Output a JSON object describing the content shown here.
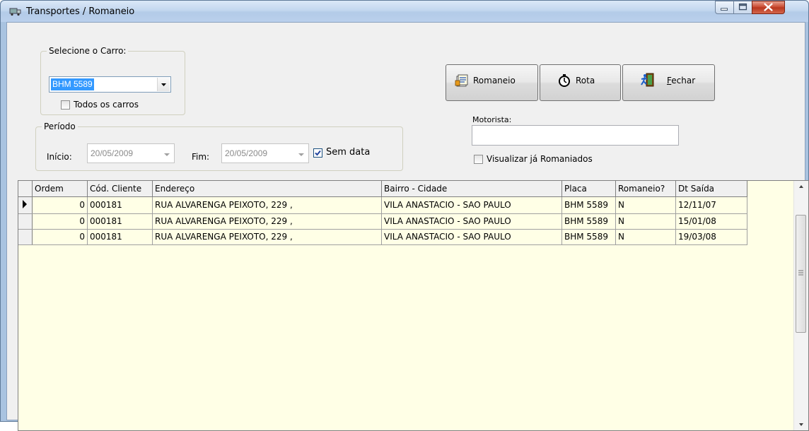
{
  "window": {
    "title": "Transportes / Romaneio"
  },
  "carro": {
    "legend": "Selecione o Carro:",
    "selected": "BHM 5589",
    "todos_label": "Todos os carros"
  },
  "periodo": {
    "legend": "Período",
    "inicio_label": "Início:",
    "inicio_value": "20/05/2009",
    "fim_label": "Fim:",
    "fim_value": "20/05/2009",
    "sem_data_label": "Sem data"
  },
  "buttons": {
    "romaneio": "Romaneio",
    "rota": "Rota",
    "fechar_underlined": "F",
    "fechar_rest": "echar"
  },
  "motorista": {
    "label": "Motorista:",
    "value": ""
  },
  "visualizar_label": "Visualizar já Romaniados",
  "grid": {
    "columns": [
      "Ordem",
      "Cód. Cliente",
      "Endereço",
      "Bairro - Cidade",
      "Placa",
      "Romaneio?",
      "Dt Saída"
    ],
    "rows": [
      [
        "0",
        "000181",
        "RUA ALVARENGA PEIXOTO, 229 ,",
        "VILA ANASTACIO - SAO PAULO",
        "BHM 5589",
        "N",
        "12/11/07"
      ],
      [
        "0",
        "000181",
        "RUA ALVARENGA PEIXOTO, 229 ,",
        "VILA ANASTACIO - SAO PAULO",
        "BHM 5589",
        "N",
        "15/01/08"
      ],
      [
        "0",
        "000181",
        "RUA ALVARENGA PEIXOTO, 229 ,",
        "VILA ANASTACIO - SAO PAULO",
        "BHM 5589",
        "N",
        "19/03/08"
      ]
    ]
  },
  "colors": {
    "grid_bg": "#ffffe6",
    "selection": "#3399ff",
    "titlebar": "#c3d7ef",
    "close": "#c7442a"
  }
}
